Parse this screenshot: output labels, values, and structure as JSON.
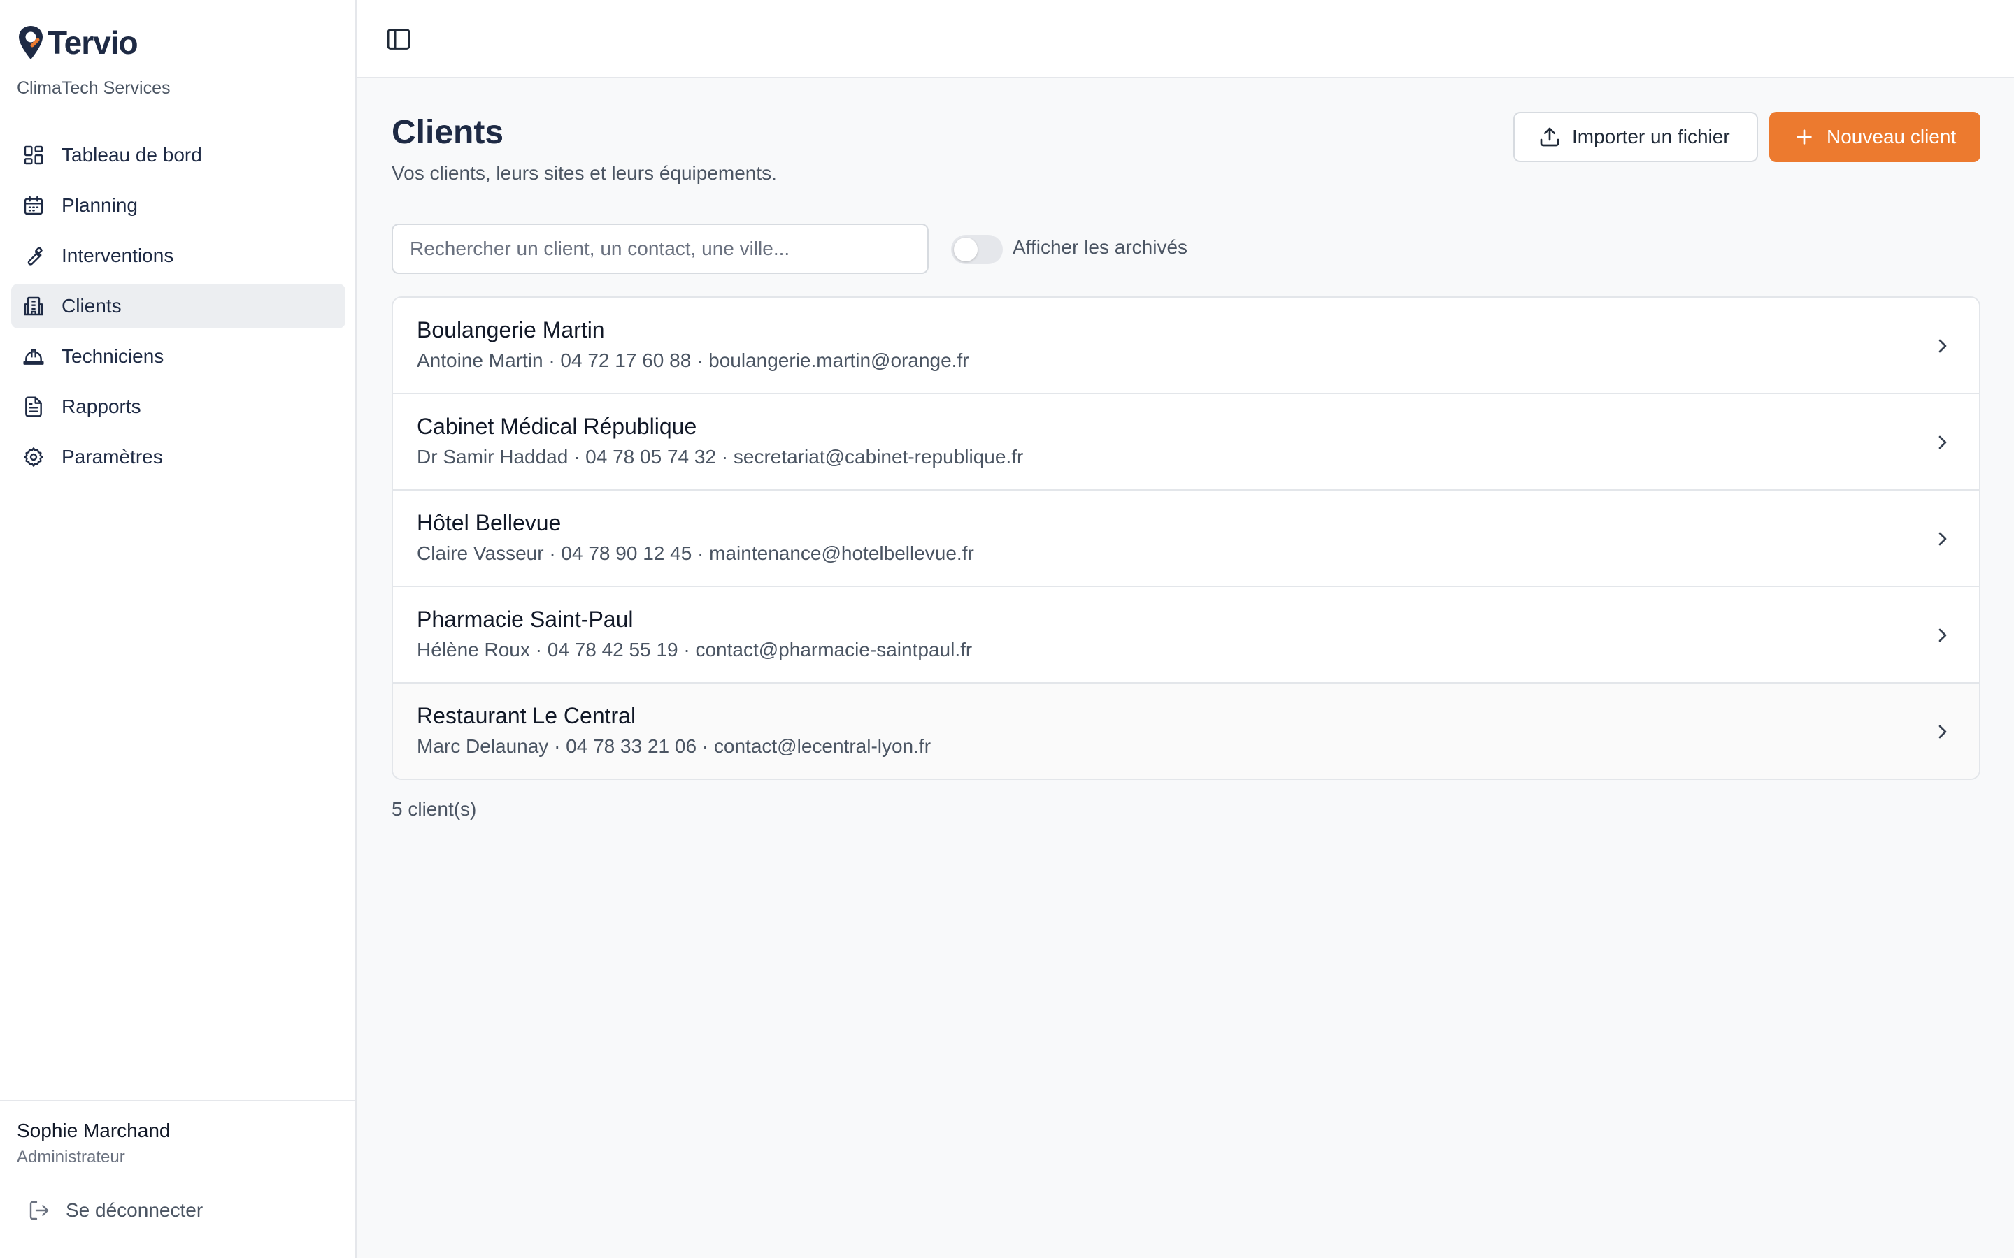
{
  "app": {
    "brand": "Tervio",
    "organization": "ClimaTech Services",
    "accent_color": "#ec7a2f",
    "brand_color": "#1e2a44"
  },
  "sidebar": {
    "items": [
      {
        "label": "Tableau de bord",
        "icon": "dashboard-icon",
        "active": false
      },
      {
        "label": "Planning",
        "icon": "calendar-icon",
        "active": false
      },
      {
        "label": "Interventions",
        "icon": "wrench-icon",
        "active": false
      },
      {
        "label": "Clients",
        "icon": "building-icon",
        "active": true
      },
      {
        "label": "Techniciens",
        "icon": "hard-hat-icon",
        "active": false
      },
      {
        "label": "Rapports",
        "icon": "document-icon",
        "active": false
      },
      {
        "label": "Paramètres",
        "icon": "gear-icon",
        "active": false
      }
    ],
    "user": {
      "name": "Sophie Marchand",
      "role": "Administrateur"
    },
    "logout_label": "Se déconnecter"
  },
  "header": {
    "toggle_icon": "sidebar-toggle-icon"
  },
  "main": {
    "title": "Clients",
    "subtitle": "Vos clients, leurs sites et leurs équipements.",
    "import_label": "Importer un fichier",
    "new_label": "Nouveau client",
    "search_placeholder": "Rechercher un client, un contact, une ville...",
    "search_value": "",
    "archived_toggle_label": "Afficher les archivés",
    "archived_toggle_on": false,
    "clients": [
      {
        "name": "Boulangerie Martin",
        "meta": "Antoine Martin · 04 72 17 60 88 · boulangerie.martin@orange.fr"
      },
      {
        "name": "Cabinet Médical République",
        "meta": "Dr Samir Haddad · 04 78 05 74 32 · secretariat@cabinet-republique.fr"
      },
      {
        "name": "Hôtel Bellevue",
        "meta": "Claire Vasseur · 04 78 90 12 45 · maintenance@hotelbellevue.fr"
      },
      {
        "name": "Pharmacie Saint-Paul",
        "meta": "Hélène Roux · 04 78 42 55 19 · contact@pharmacie-saintpaul.fr"
      },
      {
        "name": "Restaurant Le Central",
        "meta": "Marc Delaunay · 04 78 33 21 06 · contact@lecentral-lyon.fr"
      }
    ],
    "count_label": "5 client(s)"
  }
}
